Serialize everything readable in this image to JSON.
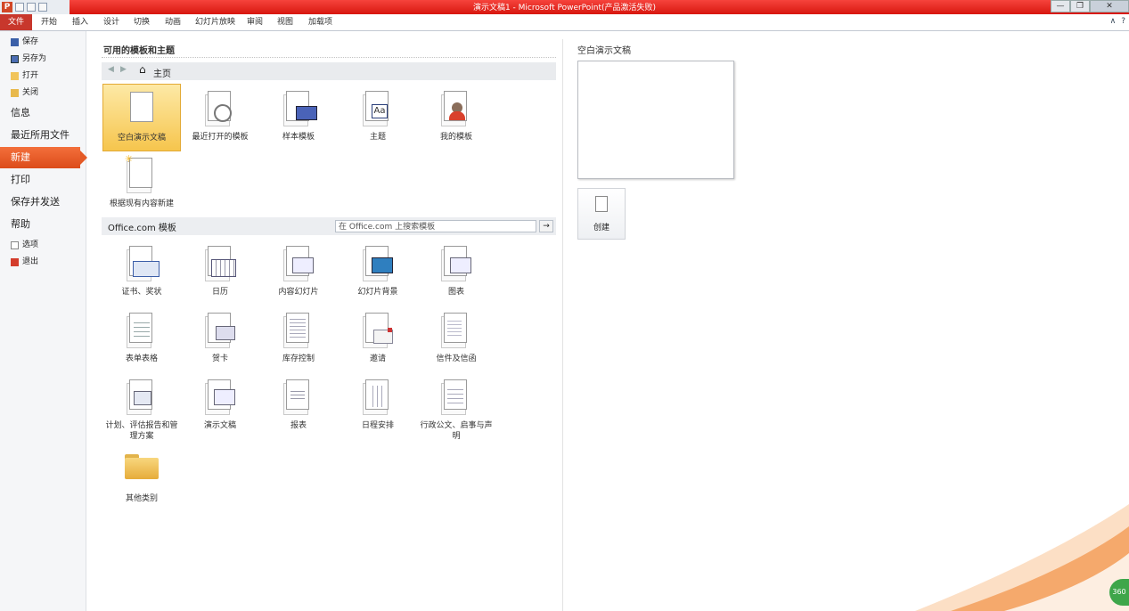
{
  "window": {
    "title": "演示文稿1 - Microsoft PowerPoint(产品激活失败)",
    "app_icon": "P",
    "controls": [
      "—",
      "❐",
      "✕"
    ]
  },
  "ribbon": {
    "file_tab": "文件",
    "tabs": [
      "开始",
      "插入",
      "设计",
      "切换",
      "动画",
      "幻灯片放映",
      "审阅",
      "视图",
      "加载项"
    ]
  },
  "nav": {
    "small_top": [
      {
        "label": "保存",
        "icon": "save-icon"
      },
      {
        "label": "另存为",
        "icon": "save-as-icon"
      },
      {
        "label": "打开",
        "icon": "open-folder-icon"
      },
      {
        "label": "关闭",
        "icon": "close-folder-icon"
      }
    ],
    "large": [
      {
        "label": "信息",
        "active": false
      },
      {
        "label": "最近所用文件",
        "active": false
      },
      {
        "label": "新建",
        "active": true
      },
      {
        "label": "打印",
        "active": false
      },
      {
        "label": "保存并发送",
        "active": false
      },
      {
        "label": "帮助",
        "active": false
      }
    ],
    "small_bottom": [
      {
        "label": "选项",
        "icon": "options-icon"
      },
      {
        "label": "退出",
        "icon": "exit-icon"
      }
    ]
  },
  "available": {
    "heading": "可用的模板和主题",
    "breadcrumb": "主页",
    "items": [
      {
        "label": "空白演示文稿",
        "selected": true,
        "icon": "blank-document-icon"
      },
      {
        "label": "最近打开的模板",
        "icon": "recent-templates-icon"
      },
      {
        "label": "样本模板",
        "icon": "sample-templates-icon"
      },
      {
        "label": "主题",
        "icon": "themes-icon"
      },
      {
        "label": "我的模板",
        "icon": "my-templates-icon"
      },
      {
        "label": "根据现有内容新建",
        "icon": "new-from-existing-icon"
      }
    ]
  },
  "office": {
    "heading": "Office.com 模板",
    "search_placeholder": "在 Office.com 上搜索模板",
    "search_go": "→",
    "items": [
      {
        "label": "证书、奖状",
        "icon": "certificate-icon"
      },
      {
        "label": "日历",
        "icon": "calendar-icon"
      },
      {
        "label": "内容幻灯片",
        "icon": "content-slides-icon"
      },
      {
        "label": "幻灯片背景",
        "icon": "slide-background-icon"
      },
      {
        "label": "图表",
        "icon": "diagram-icon"
      },
      {
        "label": "表单表格",
        "icon": "forms-icon"
      },
      {
        "label": "贺卡",
        "icon": "greeting-card-icon"
      },
      {
        "label": "库存控制",
        "icon": "inventory-icon"
      },
      {
        "label": "邀请",
        "icon": "invitation-icon"
      },
      {
        "label": "信件及信函",
        "icon": "letters-icon"
      },
      {
        "label": "计划、评估报告和管理方案",
        "icon": "plans-icon"
      },
      {
        "label": "演示文稿",
        "icon": "presentation-icon"
      },
      {
        "label": "报表",
        "icon": "reports-icon"
      },
      {
        "label": "日程安排",
        "icon": "schedule-icon"
      },
      {
        "label": "行政公文、启事与声明",
        "icon": "administrative-icon"
      },
      {
        "label": "其他类别",
        "icon": "folder-icon"
      }
    ]
  },
  "right": {
    "heading": "空白演示文稿",
    "create_label": "创建",
    "badge": "360"
  },
  "colors": {
    "title_bar": "#e31c12",
    "file_tab": "#c8372c",
    "nav_active": "#e8561f",
    "selected_tile": "#f8cf63"
  }
}
